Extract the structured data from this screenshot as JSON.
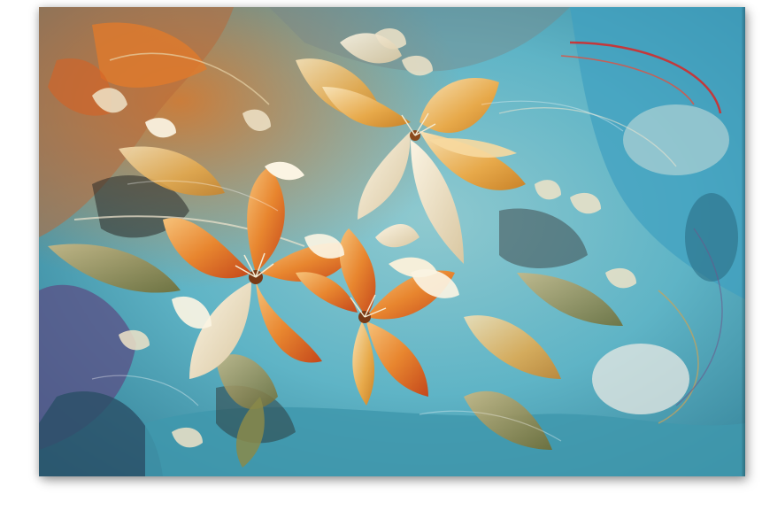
{
  "artwork": {
    "subject": "abstract-floral-canvas",
    "colors": {
      "background_teal": "#5fb4c6",
      "background_deep_teal": "#2f7c93",
      "warm_orange": "#e07a2c",
      "burnt_orange": "#c4471b",
      "golden": "#e7a94a",
      "cream": "#f1e6cf",
      "olive": "#8a8a4a",
      "slate_gray": "#7a8787",
      "purple": "#6b5a8c",
      "accent_red": "#d22c2c"
    }
  }
}
